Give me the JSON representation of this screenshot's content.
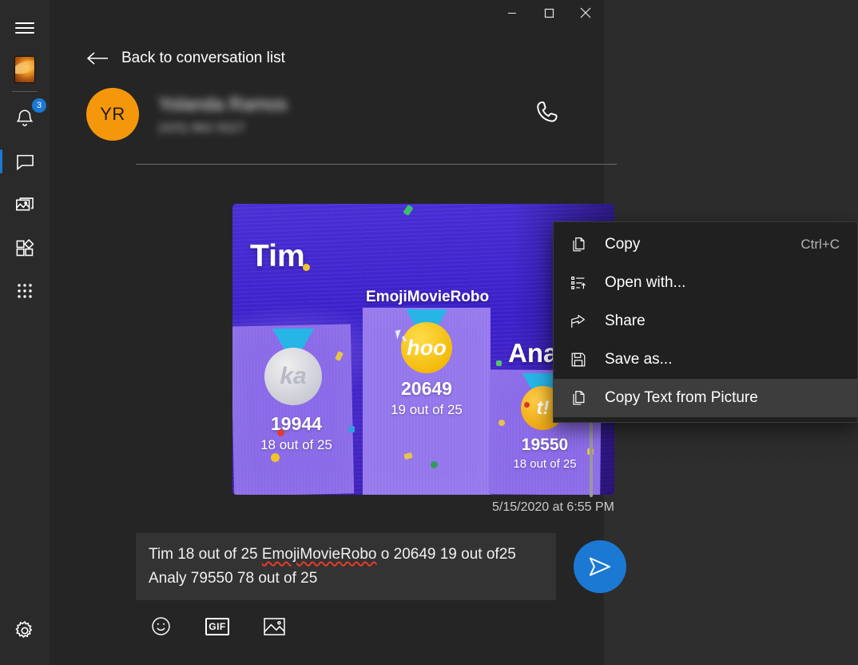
{
  "window": {
    "controls": {
      "minimize": "—",
      "maximize": "□",
      "close": "✕"
    }
  },
  "rail": {
    "menu_label": "Menu",
    "app_thumb_label": "app-thumbnail",
    "items": [
      {
        "name": "notifications",
        "label": "Notifications",
        "badge": "3"
      },
      {
        "name": "messages",
        "label": "Messages",
        "selected": true
      },
      {
        "name": "photos",
        "label": "Photos"
      },
      {
        "name": "apps",
        "label": "Apps"
      },
      {
        "name": "calls",
        "label": "Calls"
      }
    ],
    "settings_label": "Settings"
  },
  "header": {
    "back_label": "Back to conversation list",
    "avatar_initials": "YR",
    "contact_name": "Yolanda Ramos",
    "contact_phone": "(425) 882-5027",
    "call_label": "Call"
  },
  "conversation": {
    "timestamp": "5/15/2020 at 6:55 PM",
    "photo": {
      "alt": "Quiz game leaderboard podium photo",
      "title": "EmojiMovieRobo",
      "podiums": [
        {
          "name": "Tim",
          "score": "19944",
          "detail": "18 out of 25",
          "medal": "ka"
        },
        {
          "name": "EmojiMovieRobo",
          "score": "20649",
          "detail": "19 out of 25",
          "medal": "hoo"
        },
        {
          "name": "Analy",
          "score": "19550",
          "detail": "18 out of 25",
          "medal": "t!"
        }
      ]
    }
  },
  "composer": {
    "message_part_1": "Tim 18 out of 25 ",
    "message_misspelled": "EmojiMovieRobo",
    "message_part_2": " o 20649 19 out of25 Analy 79550 78 out of 25",
    "send_label": "Send",
    "tools": [
      {
        "name": "emoji",
        "label": "Emoji"
      },
      {
        "name": "gif",
        "label": "GIF"
      },
      {
        "name": "image",
        "label": "Insert picture"
      }
    ]
  },
  "context_menu": {
    "items": [
      {
        "icon": "copy-icon",
        "label": "Copy",
        "shortcut": "Ctrl+C",
        "selected": false
      },
      {
        "icon": "open-with-icon",
        "label": "Open with...",
        "shortcut": "",
        "selected": false
      },
      {
        "icon": "share-icon",
        "label": "Share",
        "shortcut": "",
        "selected": false
      },
      {
        "icon": "save-icon",
        "label": "Save as...",
        "shortcut": "",
        "selected": false
      },
      {
        "icon": "copy-text-icon",
        "label": "Copy Text from Picture",
        "shortcut": "",
        "selected": true
      }
    ]
  },
  "colors": {
    "accent": "#1b79d4",
    "avatar": "#f5970b",
    "window_bg": "#252525",
    "menu_bg": "#202020",
    "menu_selected": "#3d3d3d"
  }
}
